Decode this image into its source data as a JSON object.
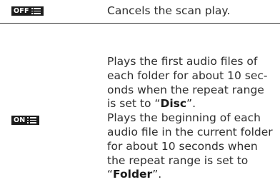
{
  "rows": [
    {
      "icon": {
        "label": "OFF",
        "name": "scan-off-icon"
      },
      "description": "Cancels the scan play."
    },
    {
      "icon": {
        "label": "ON",
        "name": "scan-on-icon"
      },
      "description_part1": "Plays the first audio files of each folder for about 10 sec-onds when the repeat range is set to “",
      "description_bold1": "Disc",
      "description_part2": "”.",
      "description_part3": "Plays the beginning of each audio file in the current folder for about 10 seconds when the repeat range is set to “",
      "description_bold2": "Folder",
      "description_part4": "”."
    }
  ]
}
